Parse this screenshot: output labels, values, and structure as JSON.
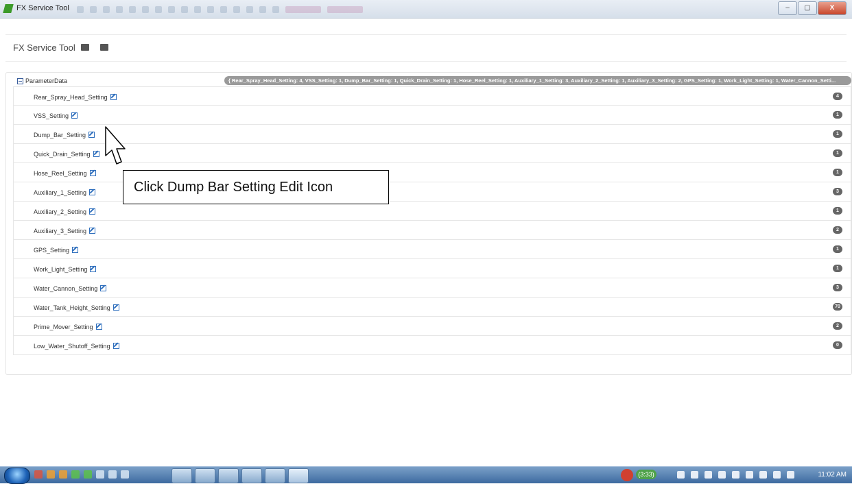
{
  "window": {
    "title": "FX Service Tool",
    "controls": {
      "minimize": "–",
      "maximize": "▢",
      "close": "X"
    }
  },
  "header": {
    "brand": "FX Service Tool",
    "icons": [
      "printer-icon",
      "export-icon"
    ]
  },
  "tree": {
    "root_label": "ParameterData",
    "root_summary": "{ Rear_Spray_Head_Setting: 4, VSS_Setting: 1, Dump_Bar_Setting: 1, Quick_Drain_Setting: 1, Hose_Reel_Setting: 1, Auxiliary_1_Setting: 3, Auxiliary_2_Setting: 1, Auxiliary_3_Setting: 2, GPS_Setting: 1, Work_Light_Setting: 1, Water_Cannon_Setti...",
    "items": [
      {
        "label": "Rear_Spray_Head_Setting",
        "value": "4"
      },
      {
        "label": "VSS_Setting",
        "value": "1"
      },
      {
        "label": "Dump_Bar_Setting",
        "value": "1"
      },
      {
        "label": "Quick_Drain_Setting",
        "value": "1"
      },
      {
        "label": "Hose_Reel_Setting",
        "value": "1"
      },
      {
        "label": "Auxiliary_1_Setting",
        "value": "3"
      },
      {
        "label": "Auxiliary_2_Setting",
        "value": "1"
      },
      {
        "label": "Auxiliary_3_Setting",
        "value": "2"
      },
      {
        "label": "GPS_Setting",
        "value": "1"
      },
      {
        "label": "Work_Light_Setting",
        "value": "1"
      },
      {
        "label": "Water_Cannon_Setting",
        "value": "3"
      },
      {
        "label": "Water_Tank_Height_Setting",
        "value": "70"
      },
      {
        "label": "Prime_Mover_Setting",
        "value": "2"
      },
      {
        "label": "Low_Water_Shutoff_Setting",
        "value": "0"
      }
    ]
  },
  "annotation": {
    "text": "Click Dump Bar Setting Edit Icon"
  },
  "taskbar": {
    "tray_pill": "(3:33)",
    "clock": "11:02 AM"
  }
}
